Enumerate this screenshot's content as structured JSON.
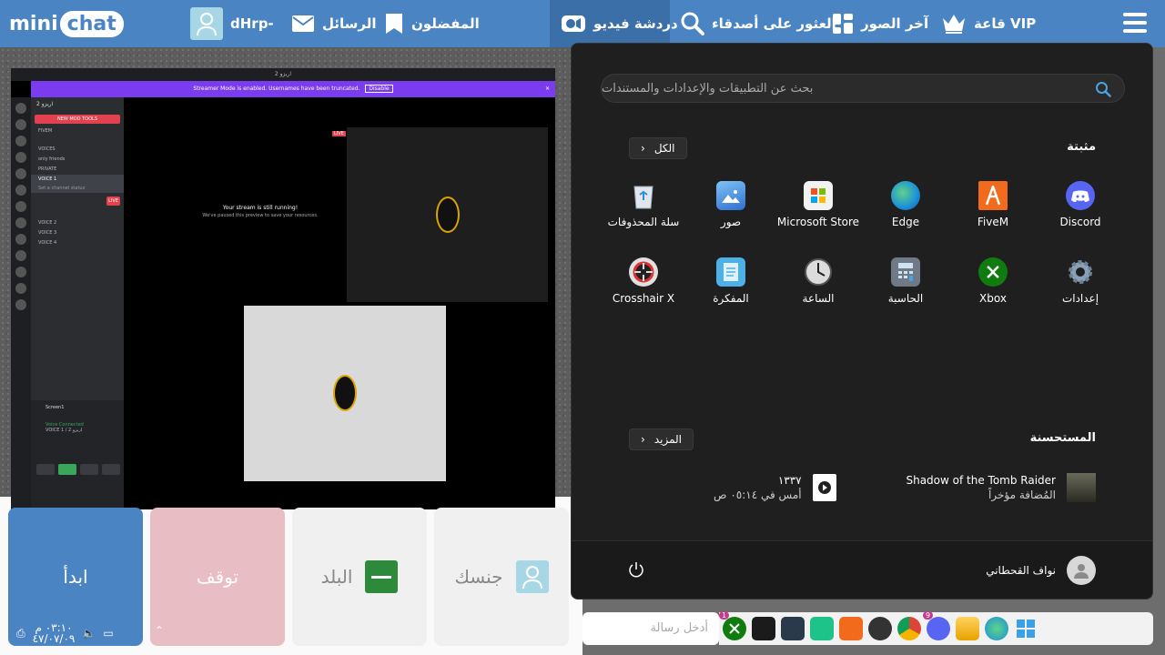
{
  "topbar": {
    "logo_mini": "mini",
    "logo_chat": "chat",
    "username": "dHrp-",
    "messages": "الرسائل",
    "favorites": "المفضلون",
    "video_chat": "دردشة فيديو",
    "find_friends": "العثور على أصدقاء",
    "recent_photos": "آخر الصور",
    "vip_hall": "قاعة VIP"
  },
  "stream": {
    "window_title": "2 اريزو",
    "banner_text": "Streamer Mode is enabled. Usernames have been truncated.",
    "banner_button": "Disable",
    "server_name": "2 اريزو",
    "new_button": "NEW MOD TOOLS",
    "channels": [
      "FIVEM",
      "VOICES",
      "only friends",
      "PRIVATE"
    ],
    "selected_channel": "VOICE 1",
    "selected_sub": "Set a channel status",
    "voice_channels": [
      "VOICE 2",
      "VOICE 3",
      "VOICE 4"
    ],
    "live_tag": "LIVE",
    "message_title": "Your stream is still running!",
    "message_sub": "We've paused this preview to save your resources.",
    "screen_label": "Screen1",
    "voice_connected": "Voice Connected",
    "voice_channel": "VOICE 1 / اريزو 2"
  },
  "controls": {
    "start": "ابدأ",
    "stop": "توقف",
    "country": "البلد",
    "gender": "جنسك"
  },
  "status": {
    "time": "٠٣:١٠ م",
    "date": "٤٧/٠٧/٠٩"
  },
  "chat_input": {
    "placeholder": "أدخل رسالة"
  },
  "start_menu": {
    "search_placeholder": "بحث عن التطبيقات والإعدادات والمستندات",
    "pinned_title": "مثبتة",
    "all_button": "الكل",
    "pinned": [
      {
        "label": "Discord",
        "icon": "discord-icon",
        "color": "#5865f2"
      },
      {
        "label": "FiveM",
        "icon": "fivem-icon",
        "color": "#f26a1b"
      },
      {
        "label": "Edge",
        "icon": "edge-icon",
        "color": "#1a8fd8"
      },
      {
        "label": "Microsoft Store",
        "icon": "store-icon",
        "color": "#f2f2f2"
      },
      {
        "label": "صور",
        "icon": "photos-icon",
        "color": "#3d8be0"
      },
      {
        "label": "سلة المحذوفات",
        "icon": "recycle-bin-icon",
        "color": "#e0e6ec"
      },
      {
        "label": "إعدادات",
        "icon": "settings-gear-icon",
        "color": "#8aa0b6"
      },
      {
        "label": "Xbox",
        "icon": "xbox-icon",
        "color": "#107c10"
      },
      {
        "label": "الحاسبة",
        "icon": "calculator-icon",
        "color": "#6f7a86"
      },
      {
        "label": "الساعة",
        "icon": "clock-icon",
        "color": "#b0b0b0"
      },
      {
        "label": "المفكرة",
        "icon": "notepad-icon",
        "color": "#4bb1e6"
      },
      {
        "label": "Crosshair X",
        "icon": "crosshair-icon",
        "color": "#e0e0e0"
      }
    ],
    "recommended_title": "المستحسنة",
    "more_button": "المزيد",
    "recommended": [
      {
        "title": "Shadow of the Tomb Raider",
        "sub": "المُضافة مؤخراً",
        "icon": "tomb-raider-icon"
      },
      {
        "title": "١٣٣٧",
        "sub": "أمس في ٠٥:١٤ ص",
        "icon": "video-file-icon"
      }
    ],
    "user_name": "نواف القحطاني"
  },
  "taskbar": {
    "badges": {
      "xbox": "1",
      "discord": "9"
    }
  }
}
